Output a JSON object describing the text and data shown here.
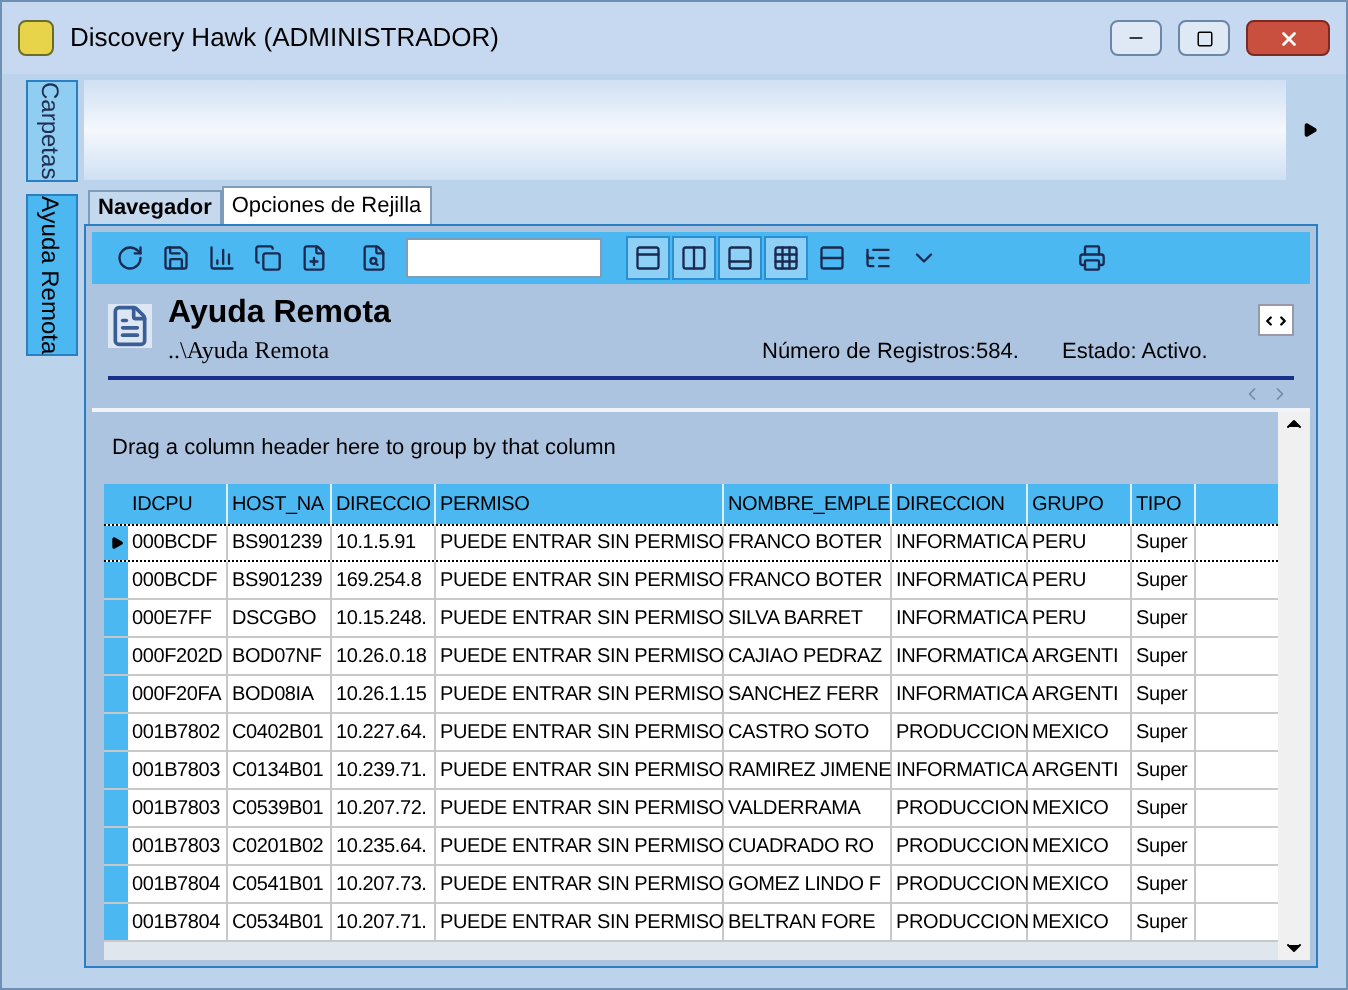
{
  "window": {
    "title": "Discovery Hawk (ADMINISTRADOR)"
  },
  "side_tabs": [
    {
      "label": "Carpetas",
      "selected": false
    },
    {
      "label": "Ayuda Remota",
      "selected": true
    }
  ],
  "tabs": [
    {
      "label": "Navegador",
      "selected": false
    },
    {
      "label": "Opciones de Rejilla",
      "selected": true
    }
  ],
  "header": {
    "title": "Ayuda Remota",
    "path": "..\\Ayuda Remota",
    "records": "Número de Registros:584.",
    "status": "Estado: Activo."
  },
  "grid": {
    "group_hint": "Drag a column header here to group by that column",
    "columns": [
      "IDCPU",
      "HOST_NA",
      "DIRECCIO",
      "PERMISO",
      "NOMBRE_EMPLE",
      "DIRECCION",
      "GRUPO",
      "TIPO"
    ],
    "rows": [
      {
        "selected": true,
        "cells": [
          "000BCDF",
          "BS901239",
          "10.1.5.91",
          "PUEDE ENTRAR SIN PERMISO",
          "FRANCO BOTER",
          "INFORMATICA",
          "PERU",
          "Super"
        ]
      },
      {
        "selected": false,
        "cells": [
          "000BCDF",
          "BS901239",
          "169.254.8",
          "PUEDE ENTRAR SIN PERMISO",
          "FRANCO BOTER",
          "INFORMATICA",
          "PERU",
          "Super"
        ]
      },
      {
        "selected": false,
        "cells": [
          "000E7FF",
          "DSCGBO",
          "10.15.248.",
          "PUEDE ENTRAR SIN PERMISO",
          "SILVA BARRET",
          "INFORMATICA",
          "PERU",
          "Super"
        ]
      },
      {
        "selected": false,
        "cells": [
          "000F202D",
          "BOD07NF",
          "10.26.0.18",
          "PUEDE ENTRAR SIN PERMISO",
          "CAJIAO PEDRAZ",
          "INFORMATICA",
          "ARGENTI",
          "Super"
        ]
      },
      {
        "selected": false,
        "cells": [
          "000F20FA",
          "BOD08IA",
          "10.26.1.15",
          "PUEDE ENTRAR SIN PERMISO",
          "SANCHEZ FERR",
          "INFORMATICA",
          "ARGENTI",
          "Super"
        ]
      },
      {
        "selected": false,
        "cells": [
          "001B7802",
          "C0402B01",
          "10.227.64.",
          "PUEDE ENTRAR SIN PERMISO",
          "CASTRO SOTO",
          "PRODUCCION",
          "MEXICO",
          "Super"
        ]
      },
      {
        "selected": false,
        "cells": [
          "001B7803",
          "C0134B01",
          "10.239.71.",
          "PUEDE ENTRAR SIN PERMISO",
          "RAMIREZ JIMENE",
          "INFORMATICA",
          "ARGENTI",
          "Super"
        ]
      },
      {
        "selected": false,
        "cells": [
          "001B7803",
          "C0539B01",
          "10.207.72.",
          "PUEDE ENTRAR SIN PERMISO",
          "VALDERRAMA",
          "PRODUCCION",
          "MEXICO",
          "Super"
        ]
      },
      {
        "selected": false,
        "cells": [
          "001B7803",
          "C0201B02",
          "10.235.64.",
          "PUEDE ENTRAR SIN PERMISO",
          "CUADRADO RO",
          "PRODUCCION",
          "MEXICO",
          "Super"
        ]
      },
      {
        "selected": false,
        "cells": [
          "001B7804",
          "C0541B01",
          "10.207.73.",
          "PUEDE ENTRAR SIN PERMISO",
          "GOMEZ LINDO F",
          "PRODUCCION",
          "MEXICO",
          "Super"
        ]
      },
      {
        "selected": false,
        "cells": [
          "001B7804",
          "C0534B01",
          "10.207.71.",
          "PUEDE ENTRAR SIN PERMISO",
          "BELTRAN FORE",
          "PRODUCCION",
          "MEXICO",
          "Super"
        ]
      }
    ]
  }
}
